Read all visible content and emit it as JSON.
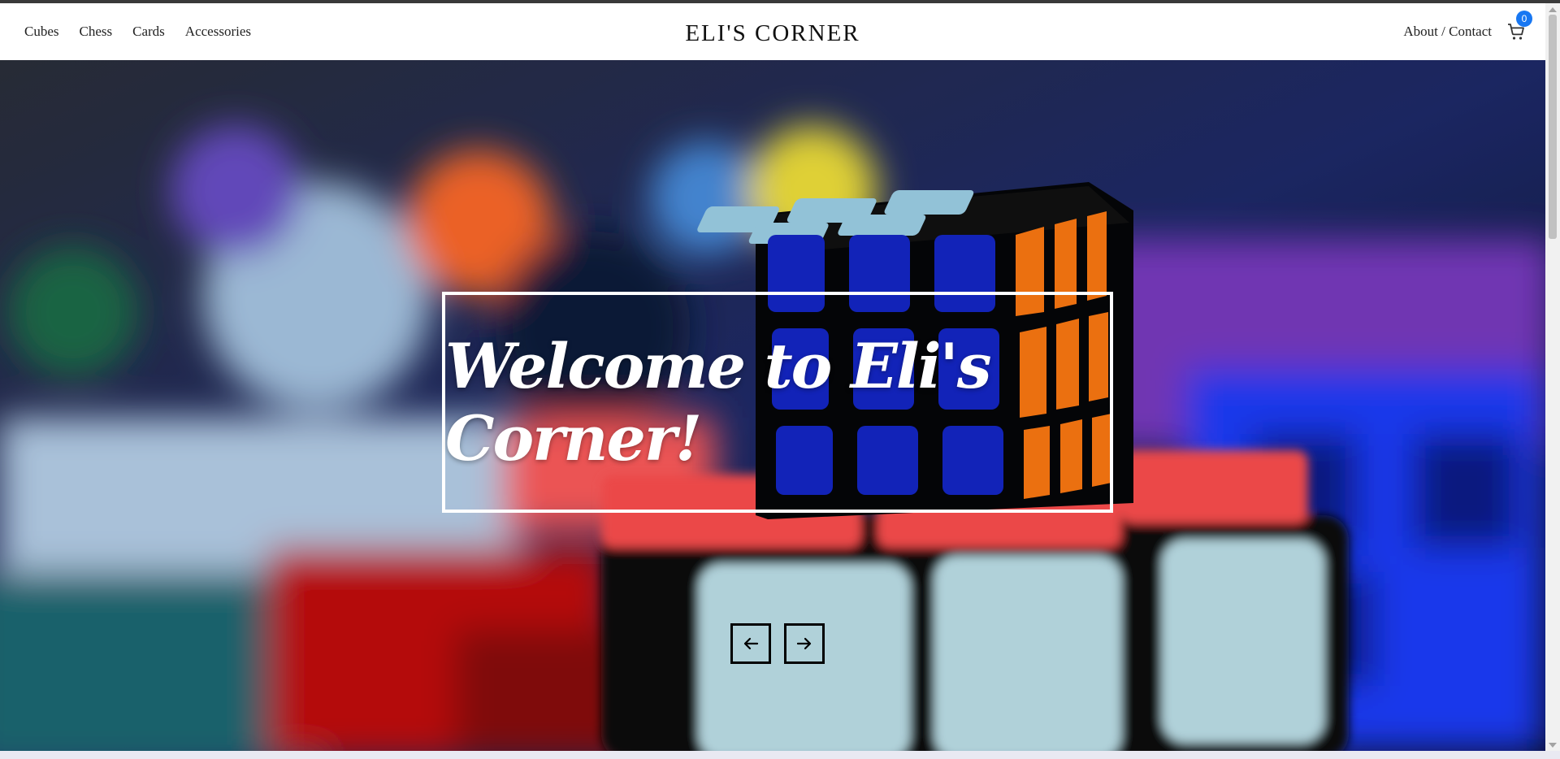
{
  "nav": {
    "items": [
      {
        "label": "Cubes"
      },
      {
        "label": "Chess"
      },
      {
        "label": "Cards"
      },
      {
        "label": "Accessories"
      }
    ]
  },
  "brand": {
    "title": "ELI'S CORNER"
  },
  "right_nav": {
    "about_label": "About / Contact",
    "cart_count": "0",
    "cart_icon": "cart-icon"
  },
  "hero": {
    "title": "Welcome to Eli's Corner!",
    "image_subject": "Rubik's cubes",
    "prev_icon": "arrow-left-icon",
    "next_icon": "arrow-right-icon"
  },
  "colors": {
    "badge": "#1877f2",
    "text": "#222222",
    "header_bg": "#ffffff"
  }
}
